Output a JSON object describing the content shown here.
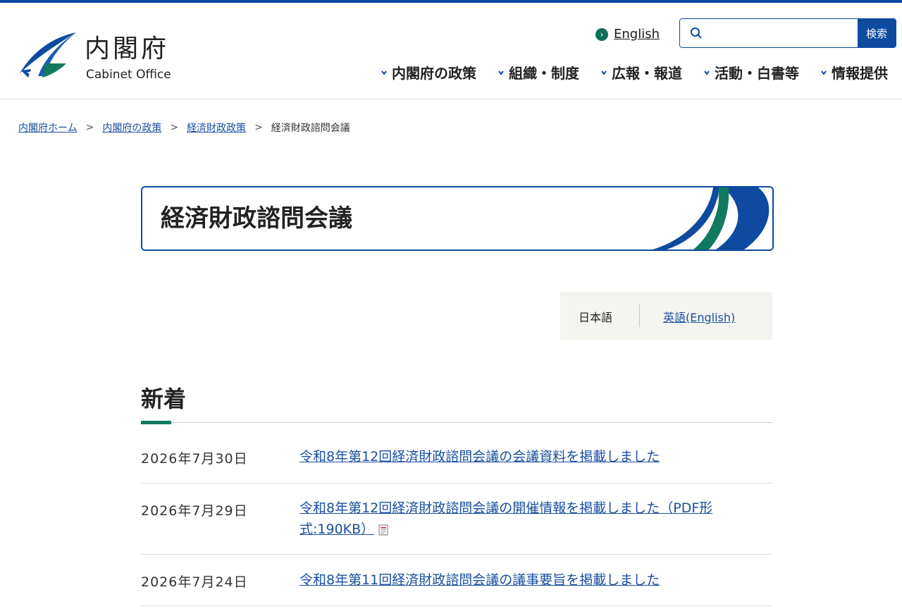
{
  "header": {
    "logo_ja": "内閣府",
    "logo_en": "Cabinet Office",
    "english_link": "English",
    "search": {
      "placeholder": "",
      "button": "検索"
    },
    "nav": [
      "内閣府の政策",
      "組織・制度",
      "広報・報道",
      "活動・白書等",
      "情報提供"
    ]
  },
  "breadcrumb": {
    "items": [
      "内閣府ホーム",
      "内閣府の政策",
      "経済財政政策"
    ],
    "current": "経済財政諮問会議",
    "separator": ">"
  },
  "page": {
    "title": "経済財政諮問会議",
    "lang_current": "日本語",
    "lang_english": "英語(English)"
  },
  "news": {
    "heading": "新着",
    "items": [
      {
        "date": "2026年7月30日",
        "text": "令和8年第12回経済財政諮問会議の会議資料を掲載しました"
      },
      {
        "date": "2026年7月29日",
        "text": "令和8年第12回経済財政諮問会議の開催情報を掲載しました（PDF形式:190KB）"
      },
      {
        "date": "2026年7月24日",
        "text": "令和8年第11回経済財政諮問会議の議事要旨を掲載しました"
      }
    ]
  },
  "colors": {
    "brand_blue": "#0d4aa0",
    "brand_green": "#0f7a5f",
    "link": "#1a4fa0"
  },
  "icons": [
    "cabinet-office-logo",
    "arrow-circle-icon",
    "search-icon",
    "chevron-down-icon",
    "pdf-icon"
  ]
}
